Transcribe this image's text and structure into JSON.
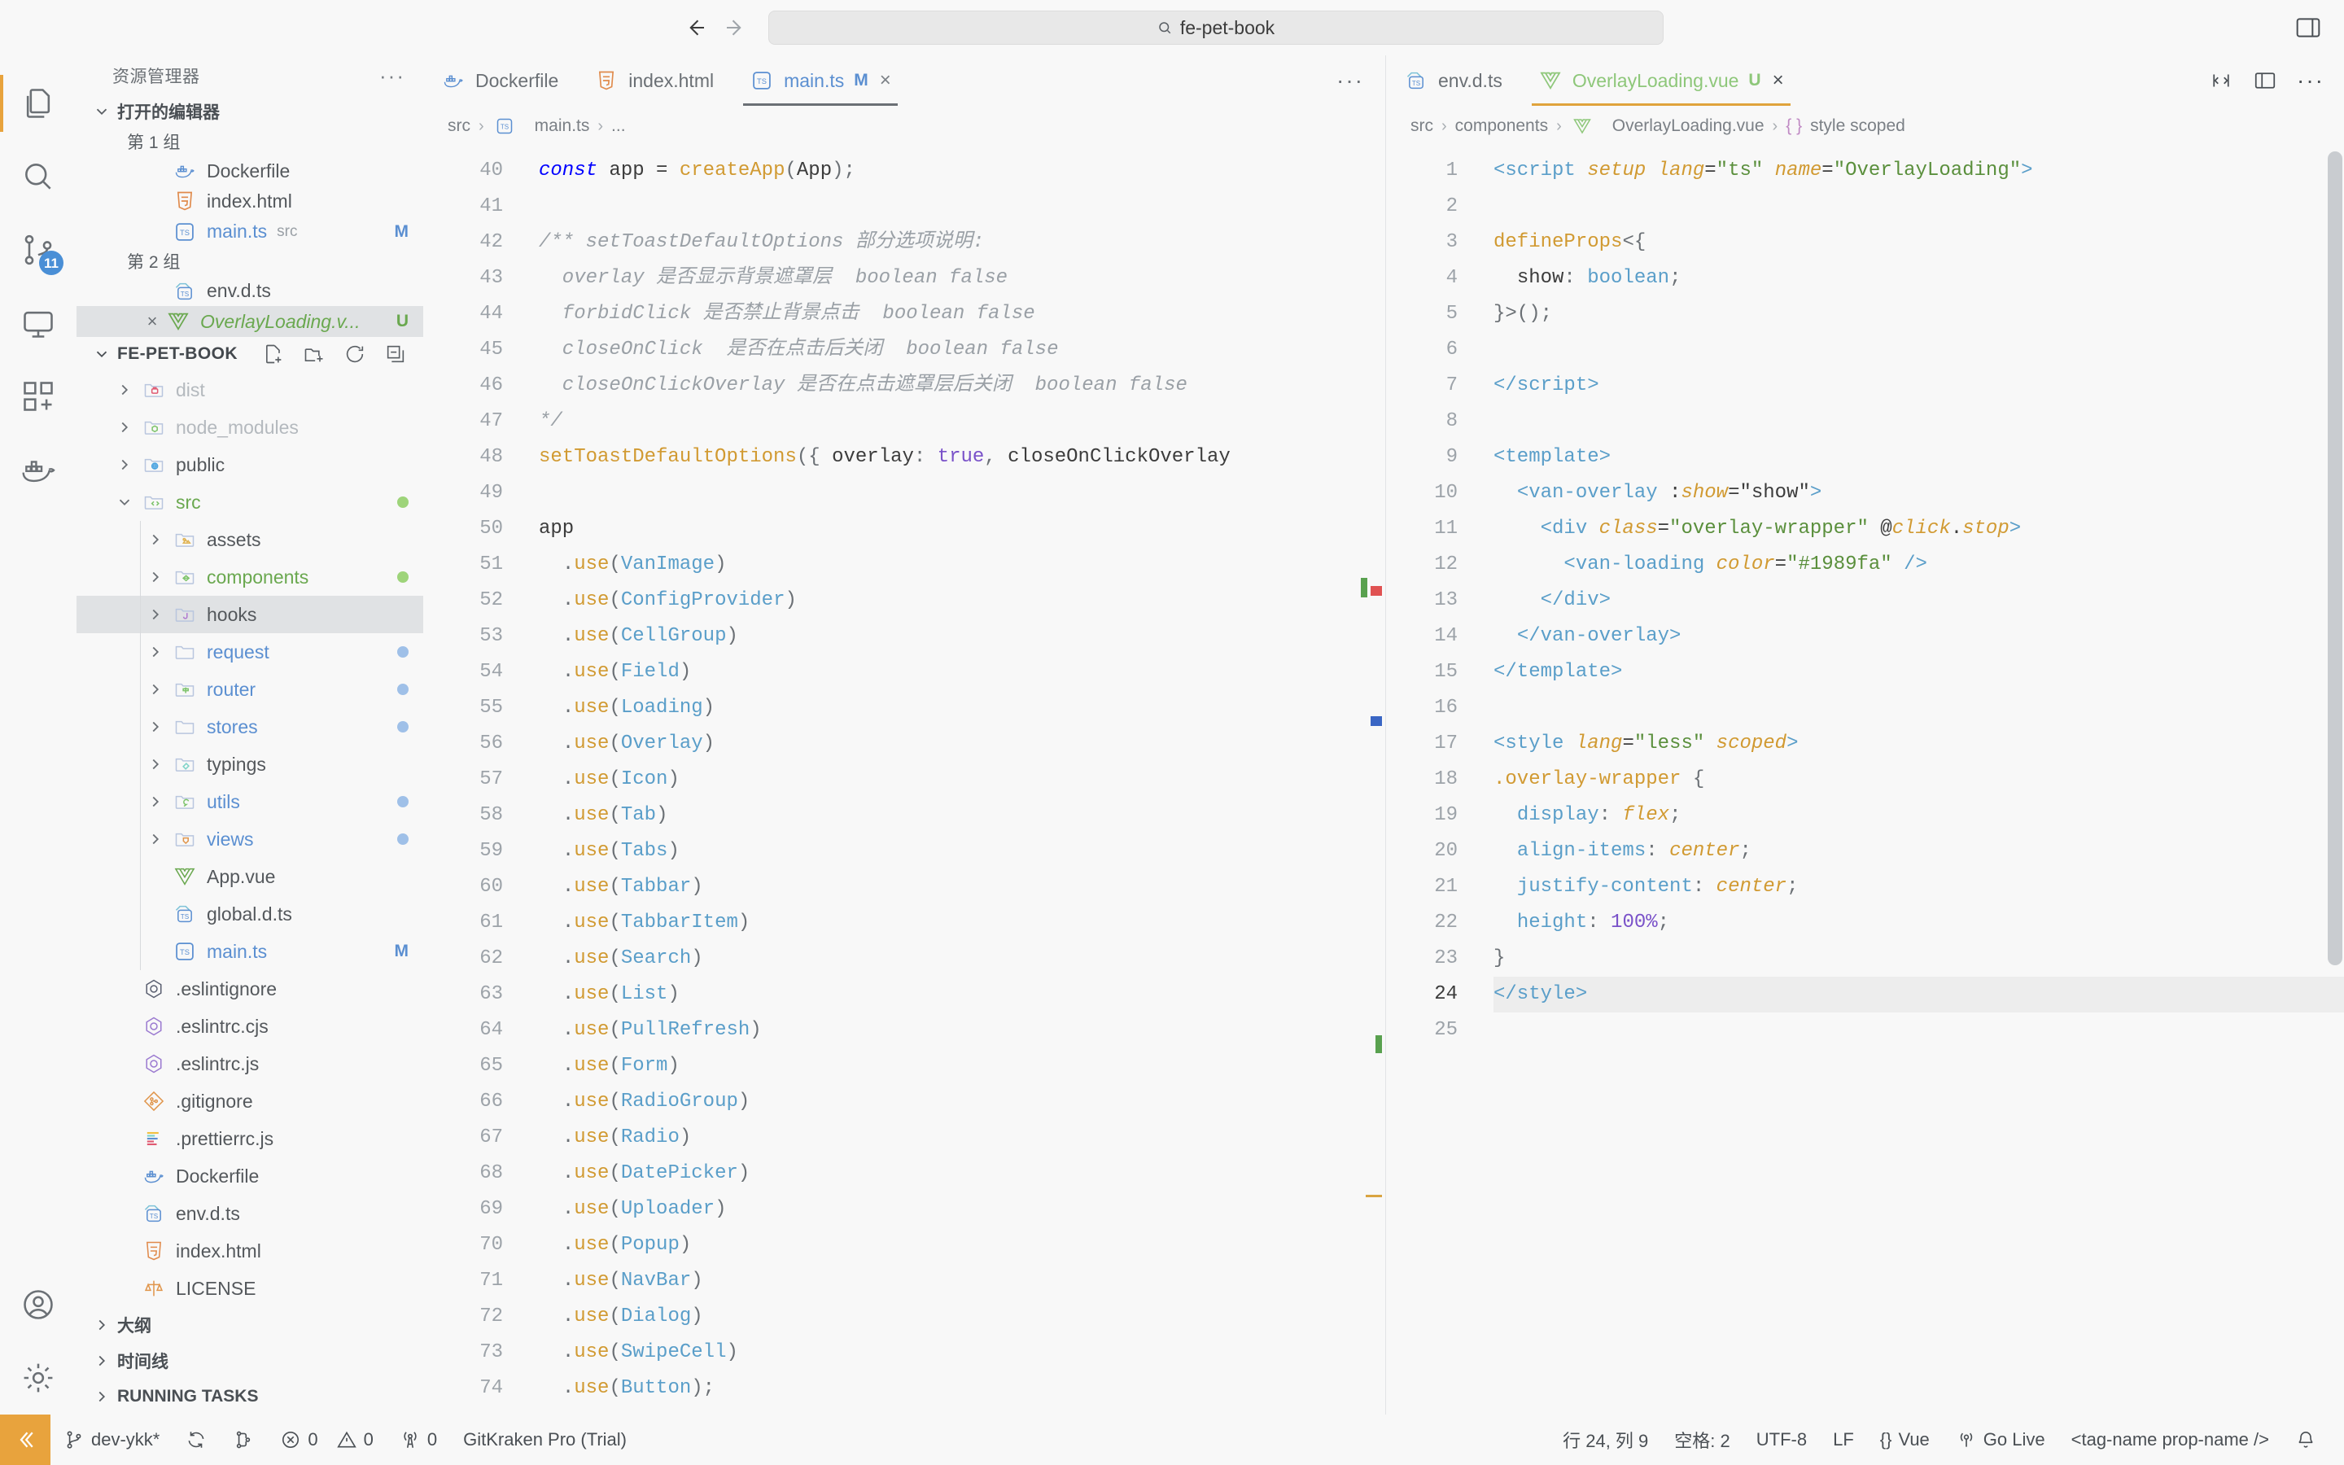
{
  "titlebar": {
    "back_icon": "arrow-left-icon",
    "forward_icon": "arrow-right-icon",
    "search_value": "fe-pet-book",
    "search_icon": "search-icon",
    "layout_icon": "toggle-panel-icon"
  },
  "activitybar": {
    "items": [
      {
        "name": "explorer",
        "icon": "files-icon",
        "badge": ""
      },
      {
        "name": "search",
        "icon": "search-icon",
        "badge": ""
      },
      {
        "name": "source-control",
        "icon": "source-control-icon",
        "badge": "11"
      },
      {
        "name": "run-and-debug",
        "icon": "debug-icon",
        "badge": ""
      },
      {
        "name": "extensions",
        "icon": "extensions-icon",
        "badge": ""
      },
      {
        "name": "docker",
        "icon": "docker-icon",
        "badge": ""
      }
    ],
    "bottom": [
      {
        "name": "accounts",
        "icon": "account-icon"
      },
      {
        "name": "settings",
        "icon": "gear-icon"
      }
    ]
  },
  "sidebar": {
    "title": "资源管理器",
    "more_icon": "ellipsis-icon",
    "open_editors": {
      "label": "打开的编辑器",
      "groups": [
        {
          "label": "第 1 组",
          "items": [
            {
              "name": "Dockerfile",
              "icon": "docker-icon",
              "sub": "",
              "badge": ""
            },
            {
              "name": "index.html",
              "icon": "html-icon",
              "sub": "",
              "badge": ""
            },
            {
              "name": "main.ts",
              "icon": "ts-icon",
              "sub": "src",
              "badge": "M"
            }
          ]
        },
        {
          "label": "第 2 组",
          "items": [
            {
              "name": "env.d.ts",
              "icon": "ts-def-icon",
              "sub": "",
              "badge": ""
            },
            {
              "name": "OverlayLoading.v...",
              "icon": "vue-icon",
              "sub": "",
              "badge": "U",
              "selected": true,
              "close": "×"
            }
          ]
        }
      ]
    },
    "project": {
      "name": "FE-PET-BOOK",
      "actions": [
        "new-file-icon",
        "new-folder-icon",
        "refresh-icon",
        "collapse-all-icon"
      ],
      "tree": [
        {
          "label": "dist",
          "icon": "folder-dist-icon",
          "type": "folder",
          "depth": 1,
          "expanded": false,
          "dim": true,
          "dot": ""
        },
        {
          "label": "node_modules",
          "icon": "folder-node-icon",
          "type": "folder",
          "depth": 1,
          "expanded": false,
          "dim": true,
          "dot": ""
        },
        {
          "label": "public",
          "icon": "folder-public-icon",
          "type": "folder",
          "depth": 1,
          "expanded": false,
          "dim": false,
          "dot": ""
        },
        {
          "label": "src",
          "icon": "folder-src-icon",
          "type": "folder",
          "depth": 1,
          "expanded": true,
          "color": "#6aa84f",
          "dot": "#9ed47a"
        },
        {
          "label": "assets",
          "icon": "folder-assets-icon",
          "type": "folder",
          "depth": 2,
          "expanded": false,
          "dot": ""
        },
        {
          "label": "components",
          "icon": "folder-components-icon",
          "type": "folder",
          "depth": 2,
          "expanded": false,
          "color": "#6aa84f",
          "dot": "#9ed47a"
        },
        {
          "label": "hooks",
          "icon": "folder-hooks-icon",
          "type": "folder",
          "depth": 2,
          "expanded": false,
          "selected": true,
          "dot": ""
        },
        {
          "label": "request",
          "icon": "folder-plain-icon",
          "type": "folder",
          "depth": 2,
          "expanded": false,
          "color": "#5b8fd1",
          "dot": "#9fc0e8"
        },
        {
          "label": "router",
          "icon": "folder-router-icon",
          "type": "folder",
          "depth": 2,
          "expanded": false,
          "color": "#5b8fd1",
          "dot": "#9fc0e8"
        },
        {
          "label": "stores",
          "icon": "folder-plain-icon",
          "type": "folder",
          "depth": 2,
          "expanded": false,
          "color": "#5b8fd1",
          "dot": "#9fc0e8"
        },
        {
          "label": "typings",
          "icon": "folder-typings-icon",
          "type": "folder",
          "depth": 2,
          "expanded": false,
          "dot": ""
        },
        {
          "label": "utils",
          "icon": "folder-utils-icon",
          "type": "folder",
          "depth": 2,
          "expanded": false,
          "color": "#5b8fd1",
          "dot": "#9fc0e8"
        },
        {
          "label": "views",
          "icon": "folder-views-icon",
          "type": "folder",
          "depth": 2,
          "expanded": false,
          "color": "#5b8fd1",
          "dot": "#9fc0e8"
        },
        {
          "label": "App.vue",
          "icon": "vue-icon",
          "type": "file",
          "depth": 2,
          "dot": ""
        },
        {
          "label": "global.d.ts",
          "icon": "ts-def-icon",
          "type": "file",
          "depth": 2,
          "dot": ""
        },
        {
          "label": "main.ts",
          "icon": "ts-icon",
          "type": "file",
          "depth": 2,
          "color": "#5b8fd1",
          "badge": "M"
        },
        {
          "label": ".eslintignore",
          "icon": "eslint-gray-icon",
          "type": "file",
          "depth": 1
        },
        {
          "label": ".eslintrc.cjs",
          "icon": "eslint-icon",
          "type": "file",
          "depth": 1
        },
        {
          "label": ".eslintrc.js",
          "icon": "eslint-icon",
          "type": "file",
          "depth": 1
        },
        {
          "label": ".gitignore",
          "icon": "git-icon",
          "type": "file",
          "depth": 1
        },
        {
          "label": ".prettierrc.js",
          "icon": "prettier-icon",
          "type": "file",
          "depth": 1
        },
        {
          "label": "Dockerfile",
          "icon": "docker-icon",
          "type": "file",
          "depth": 1
        },
        {
          "label": "env.d.ts",
          "icon": "ts-def-icon",
          "type": "file",
          "depth": 1
        },
        {
          "label": "index.html",
          "icon": "html-icon",
          "type": "file",
          "depth": 1
        },
        {
          "label": "LICENSE",
          "icon": "license-icon",
          "type": "file",
          "depth": 1
        }
      ]
    },
    "bottom_sections": [
      {
        "label": "大纲"
      },
      {
        "label": "时间线"
      },
      {
        "label": "RUNNING TASKS"
      }
    ]
  },
  "editor_left": {
    "tabs": [
      {
        "label": "Dockerfile",
        "icon": "docker-icon",
        "badge": "",
        "active": false
      },
      {
        "label": "index.html",
        "icon": "html-icon",
        "badge": "",
        "active": false
      },
      {
        "label": "main.ts",
        "icon": "ts-icon",
        "badge": "M",
        "badge_kind": "mod",
        "active": true,
        "close": "×"
      }
    ],
    "more_icon": "ellipsis-icon",
    "breadcrumb": [
      "src",
      "main.ts",
      "..."
    ],
    "breadcrumb_icon": "ts-icon",
    "first_line": 40,
    "lines": [
      {
        "n": 40,
        "html": "<span class=\"c-kw italic\">const</span> <span class=\"c-plain\">app</span> <span class=\"c-op\">=</span> <span class=\"c-fn\">createApp</span><span class=\"c-punc\">(</span><span class=\"c-plain\">App</span><span class=\"c-punc\">);</span>"
      },
      {
        "n": 41,
        "html": ""
      },
      {
        "n": 42,
        "html": "<span class=\"c-com\">/** setToastDefaultOptions 部分选项说明:</span>"
      },
      {
        "n": 43,
        "html": "<span class=\"c-com\">  overlay 是否显示背景遮罩层  boolean false</span>"
      },
      {
        "n": 44,
        "html": "<span class=\"c-com\">  forbidClick 是否禁止背景点击  boolean false</span>"
      },
      {
        "n": 45,
        "html": "<span class=\"c-com\">  closeOnClick  是否在点击后关闭  boolean false</span>"
      },
      {
        "n": 46,
        "html": "<span class=\"c-com\">  closeOnClickOverlay 是否在点击遮罩层后关闭  boolean false</span>"
      },
      {
        "n": 47,
        "html": "<span class=\"c-com\">*/</span>"
      },
      {
        "n": 48,
        "html": "<span class=\"c-fn\">setToastDefaultOptions</span><span class=\"c-punc\">({ </span><span class=\"c-plain\">overlay</span><span class=\"c-punc\">: </span><span class=\"c-const\">true</span><span class=\"c-punc\">, </span><span class=\"c-plain\">closeOnClickOverlay</span>"
      },
      {
        "n": 49,
        "html": ""
      },
      {
        "n": 50,
        "html": "<span class=\"c-plain\">app</span>"
      },
      {
        "n": 51,
        "html": "  <span class=\"c-punc\">.</span><span class=\"c-fn\">use</span><span class=\"c-punc\">(</span><span class=\"c-type\">VanImage</span><span class=\"c-punc\">)</span>"
      },
      {
        "n": 52,
        "html": "  <span class=\"c-punc\">.</span><span class=\"c-fn\">use</span><span class=\"c-punc\">(</span><span class=\"c-type\">ConfigProvider</span><span class=\"c-punc\">)</span>"
      },
      {
        "n": 53,
        "html": "  <span class=\"c-punc\">.</span><span class=\"c-fn\">use</span><span class=\"c-punc\">(</span><span class=\"c-type\">CellGroup</span><span class=\"c-punc\">)</span>"
      },
      {
        "n": 54,
        "html": "  <span class=\"c-punc\">.</span><span class=\"c-fn\">use</span><span class=\"c-punc\">(</span><span class=\"c-type\">Field</span><span class=\"c-punc\">)</span>"
      },
      {
        "n": 55,
        "html": "  <span class=\"c-punc\">.</span><span class=\"c-fn\">use</span><span class=\"c-punc\">(</span><span class=\"c-type\">Loading</span><span class=\"c-punc\">)</span>"
      },
      {
        "n": 56,
        "html": "  <span class=\"c-punc\">.</span><span class=\"c-fn\">use</span><span class=\"c-punc\">(</span><span class=\"c-type\">Overlay</span><span class=\"c-punc\">)</span>"
      },
      {
        "n": 57,
        "html": "  <span class=\"c-punc\">.</span><span class=\"c-fn\">use</span><span class=\"c-punc\">(</span><span class=\"c-type\">Icon</span><span class=\"c-punc\">)</span>"
      },
      {
        "n": 58,
        "html": "  <span class=\"c-punc\">.</span><span class=\"c-fn\">use</span><span class=\"c-punc\">(</span><span class=\"c-type\">Tab</span><span class=\"c-punc\">)</span>"
      },
      {
        "n": 59,
        "html": "  <span class=\"c-punc\">.</span><span class=\"c-fn\">use</span><span class=\"c-punc\">(</span><span class=\"c-type\">Tabs</span><span class=\"c-punc\">)</span>"
      },
      {
        "n": 60,
        "html": "  <span class=\"c-punc\">.</span><span class=\"c-fn\">use</span><span class=\"c-punc\">(</span><span class=\"c-type\">Tabbar</span><span class=\"c-punc\">)</span>"
      },
      {
        "n": 61,
        "html": "  <span class=\"c-punc\">.</span><span class=\"c-fn\">use</span><span class=\"c-punc\">(</span><span class=\"c-type\">TabbarItem</span><span class=\"c-punc\">)</span>"
      },
      {
        "n": 62,
        "html": "  <span class=\"c-punc\">.</span><span class=\"c-fn\">use</span><span class=\"c-punc\">(</span><span class=\"c-type\">Search</span><span class=\"c-punc\">)</span>"
      },
      {
        "n": 63,
        "html": "  <span class=\"c-punc\">.</span><span class=\"c-fn\">use</span><span class=\"c-punc\">(</span><span class=\"c-type\">List</span><span class=\"c-punc\">)</span>"
      },
      {
        "n": 64,
        "html": "  <span class=\"c-punc\">.</span><span class=\"c-fn\">use</span><span class=\"c-punc\">(</span><span class=\"c-type\">PullRefresh</span><span class=\"c-punc\">)</span>"
      },
      {
        "n": 65,
        "html": "  <span class=\"c-punc\">.</span><span class=\"c-fn\">use</span><span class=\"c-punc\">(</span><span class=\"c-type\">Form</span><span class=\"c-punc\">)</span>"
      },
      {
        "n": 66,
        "html": "  <span class=\"c-punc\">.</span><span class=\"c-fn\">use</span><span class=\"c-punc\">(</span><span class=\"c-type\">RadioGroup</span><span class=\"c-punc\">)</span>"
      },
      {
        "n": 67,
        "html": "  <span class=\"c-punc\">.</span><span class=\"c-fn\">use</span><span class=\"c-punc\">(</span><span class=\"c-type\">Radio</span><span class=\"c-punc\">)</span>"
      },
      {
        "n": 68,
        "html": "  <span class=\"c-punc\">.</span><span class=\"c-fn\">use</span><span class=\"c-punc\">(</span><span class=\"c-type\">DatePicker</span><span class=\"c-punc\">)</span>"
      },
      {
        "n": 69,
        "html": "  <span class=\"c-punc\">.</span><span class=\"c-fn\">use</span><span class=\"c-punc\">(</span><span class=\"c-type\">Uploader</span><span class=\"c-punc\">)</span>"
      },
      {
        "n": 70,
        "html": "  <span class=\"c-punc\">.</span><span class=\"c-fn\">use</span><span class=\"c-punc\">(</span><span class=\"c-type\">Popup</span><span class=\"c-punc\">)</span>"
      },
      {
        "n": 71,
        "html": "  <span class=\"c-punc\">.</span><span class=\"c-fn\">use</span><span class=\"c-punc\">(</span><span class=\"c-type\">NavBar</span><span class=\"c-punc\">)</span>"
      },
      {
        "n": 72,
        "html": "  <span class=\"c-punc\">.</span><span class=\"c-fn\">use</span><span class=\"c-punc\">(</span><span class=\"c-type\">Dialog</span><span class=\"c-punc\">)</span>"
      },
      {
        "n": 73,
        "html": "  <span class=\"c-punc\">.</span><span class=\"c-fn\">use</span><span class=\"c-punc\">(</span><span class=\"c-type\">SwipeCell</span><span class=\"c-punc\">)</span>"
      },
      {
        "n": 74,
        "html": "  <span class=\"c-punc\">.</span><span class=\"c-fn\">use</span><span class=\"c-punc\">(</span><span class=\"c-type\">Button</span><span class=\"c-punc\">);</span>"
      },
      {
        "n": 75,
        "html": ""
      }
    ]
  },
  "editor_right": {
    "tabs": [
      {
        "label": "env.d.ts",
        "icon": "ts-def-icon",
        "badge": "",
        "active": false
      },
      {
        "label": "OverlayLoading.vue",
        "icon": "vue-icon",
        "badge": "U",
        "badge_kind": "unt",
        "active": true,
        "close": "×"
      }
    ],
    "actions": [
      "split-editor-icon",
      "layout-icon",
      "ellipsis-icon"
    ],
    "breadcrumb": [
      "src",
      "components",
      "OverlayLoading.vue",
      "style scoped"
    ],
    "lines": [
      {
        "n": 1,
        "html": "<span class=\"c-tag\">&lt;script</span> <span class=\"c-attr\">setup</span> <span class=\"c-attr\">lang</span><span class=\"c-op\">=</span><span class=\"c-str\">\"ts\"</span> <span class=\"c-attr\">name</span><span class=\"c-op\">=</span><span class=\"c-str\">\"OverlayLoading\"</span><span class=\"c-tag\">&gt;</span>"
      },
      {
        "n": 2,
        "html": ""
      },
      {
        "n": 3,
        "html": "<span class=\"c-fn\">defineProps</span><span class=\"c-punc\">&lt;{</span>"
      },
      {
        "n": 4,
        "html": "  <span class=\"c-plain\">show</span><span class=\"c-punc\">: </span><span class=\"c-type\">boolean</span><span class=\"c-punc\">;</span>"
      },
      {
        "n": 5,
        "html": "<span class=\"c-punc\">}&gt;();</span>"
      },
      {
        "n": 6,
        "html": ""
      },
      {
        "n": 7,
        "html": "<span class=\"c-tag\">&lt;/script&gt;</span>"
      },
      {
        "n": 8,
        "html": ""
      },
      {
        "n": 9,
        "html": "<span class=\"c-tag\">&lt;template&gt;</span>"
      },
      {
        "n": 10,
        "html": "  <span class=\"c-tag\">&lt;van-overlay</span> <span class=\"c-plain\">:</span><span class=\"c-attr\">show</span><span class=\"c-op\">=</span><span class=\"c-plain\">\"show\"</span><span class=\"c-tag\">&gt;</span>"
      },
      {
        "n": 11,
        "html": "    <span class=\"c-tag\">&lt;div</span> <span class=\"c-attr\">class</span><span class=\"c-op\">=</span><span class=\"c-str\">\"overlay-wrapper\"</span> <span class=\"c-plain\">@</span><span class=\"c-attr\">click</span><span class=\"c-plain\">.</span><span class=\"c-attr\">stop</span><span class=\"c-tag\">&gt;</span>"
      },
      {
        "n": 12,
        "html": "      <span class=\"c-tag\">&lt;van-loading</span> <span class=\"c-attr\">color</span><span class=\"c-op\">=</span><span class=\"c-str\">\"#1989fa\"</span> <span class=\"c-tag\">/&gt;</span>"
      },
      {
        "n": 13,
        "html": "    <span class=\"c-tag\">&lt;/div&gt;</span>"
      },
      {
        "n": 14,
        "html": "  <span class=\"c-tag\">&lt;/van-overlay&gt;</span>"
      },
      {
        "n": 15,
        "html": "<span class=\"c-tag\">&lt;/template&gt;</span>"
      },
      {
        "n": 16,
        "html": ""
      },
      {
        "n": 17,
        "html": "<span class=\"c-tag\">&lt;style</span> <span class=\"c-attr\">lang</span><span class=\"c-op\">=</span><span class=\"c-str\">\"less\"</span> <span class=\"c-attr\">scoped</span><span class=\"c-tag\">&gt;</span>"
      },
      {
        "n": 18,
        "html": "<span class=\"c-fn\">.overlay-wrapper</span> <span class=\"c-punc\">{</span>"
      },
      {
        "n": 19,
        "html": "  <span class=\"c-type\">display</span><span class=\"c-punc\">: </span><span class=\"c-attr\">flex</span><span class=\"c-punc\">;</span>"
      },
      {
        "n": 20,
        "html": "  <span class=\"c-type\">align-items</span><span class=\"c-punc\">: </span><span class=\"c-attr\">center</span><span class=\"c-punc\">;</span>"
      },
      {
        "n": 21,
        "html": "  <span class=\"c-type\">justify-content</span><span class=\"c-punc\">: </span><span class=\"c-attr\">center</span><span class=\"c-punc\">;</span>"
      },
      {
        "n": 22,
        "html": "  <span class=\"c-type\">height</span><span class=\"c-punc\">: </span><span class=\"c-num\">100%</span><span class=\"c-punc\">;</span>"
      },
      {
        "n": 23,
        "html": "<span class=\"c-punc\">}</span>"
      },
      {
        "n": 24,
        "html": "<span class=\"c-tag\">&lt;/style&gt;</span>",
        "hl": true
      },
      {
        "n": 25,
        "html": ""
      }
    ]
  },
  "statusbar": {
    "remote_icon": "remote-window-icon",
    "left": [
      {
        "icon": "git-branch-icon",
        "label": "dev-ykk*"
      },
      {
        "icon": "sync-icon",
        "label": ""
      },
      {
        "icon": "git-pr-icon",
        "label": ""
      },
      {
        "icon": "error-icon",
        "label": "0"
      },
      {
        "icon": "warning-icon",
        "label": "0"
      },
      {
        "icon": "radio-tower-icon",
        "label": "0"
      },
      {
        "icon": "",
        "label": "GitKraken Pro (Trial)"
      }
    ],
    "right": [
      {
        "icon": "",
        "label": "行 24, 列 9"
      },
      {
        "icon": "",
        "label": "空格: 2"
      },
      {
        "icon": "",
        "label": "UTF-8"
      },
      {
        "icon": "",
        "label": "LF"
      },
      {
        "icon": "braces-icon",
        "label": "Vue"
      },
      {
        "icon": "broadcast-icon",
        "label": "Go Live"
      },
      {
        "icon": "",
        "label": "<tag-name prop-name />"
      },
      {
        "icon": "bell-icon",
        "label": ""
      }
    ]
  }
}
